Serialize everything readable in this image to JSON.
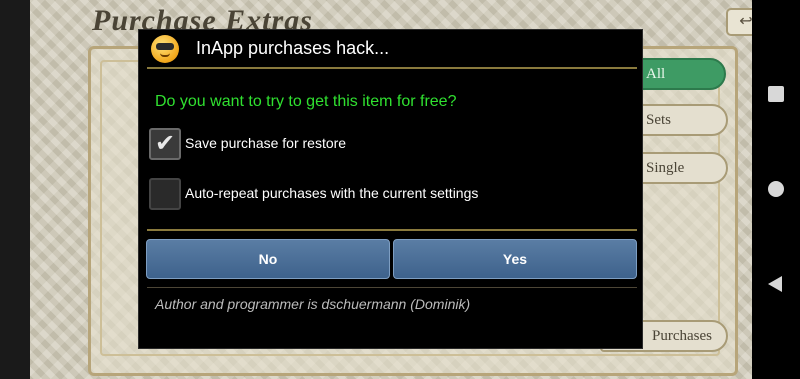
{
  "game": {
    "title": "Purchase Extras",
    "back_glyph": "↩",
    "tabs": {
      "all": "All",
      "sets": "Sets",
      "single": "Single",
      "purchases": "Purchases"
    }
  },
  "dialog": {
    "icon": "cool-smiley-icon",
    "title": "InApp purchases hack...",
    "question": "Do you want to try to get this item for free?",
    "options": [
      {
        "label": "Save purchase for restore",
        "checked": true
      },
      {
        "label": "Auto-repeat purchases with the current settings",
        "checked": false
      }
    ],
    "check_glyph": "✔",
    "buttons": {
      "no": "No",
      "yes": "Yes"
    },
    "footer": "Author and programmer is dschuermann (Dominik)"
  },
  "navbar": {
    "recents_icon": "square-icon",
    "home_icon": "circle-icon",
    "back_icon": "triangle-back-icon"
  },
  "colors": {
    "question": "#30e030",
    "button": "#4a6f98",
    "divider": "#8a7a3d",
    "tab_active": "#3e9b64"
  }
}
